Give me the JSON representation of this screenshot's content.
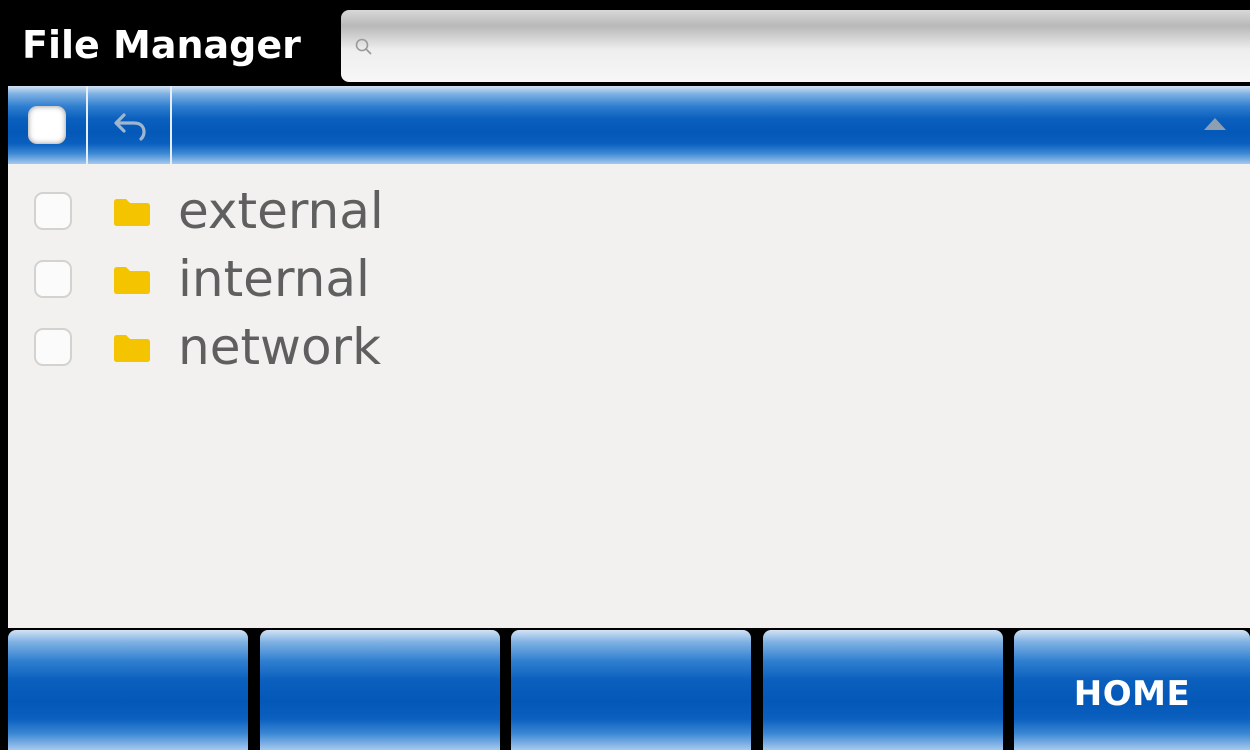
{
  "app": {
    "title": "File Manager"
  },
  "search": {
    "value": "",
    "placeholder": ""
  },
  "path_bar": {
    "path": "",
    "icons": [
      "checkbox",
      "back-arrow-icon",
      "scroll-up-triangle-icon"
    ]
  },
  "files": [
    {
      "name": "external",
      "type": "folder",
      "checked": false
    },
    {
      "name": "internal",
      "type": "folder",
      "checked": false
    },
    {
      "name": "network",
      "type": "folder",
      "checked": false
    }
  ],
  "softkeys": [
    {
      "label": ""
    },
    {
      "label": ""
    },
    {
      "label": ""
    },
    {
      "label": ""
    },
    {
      "label": "HOME"
    }
  ],
  "colors": {
    "accent_blue": "#0358b8",
    "folder_yellow": "#f5c400",
    "list_background": "#f2f1f0",
    "file_text": "#5f5f5f",
    "title_bar": "#000000"
  }
}
